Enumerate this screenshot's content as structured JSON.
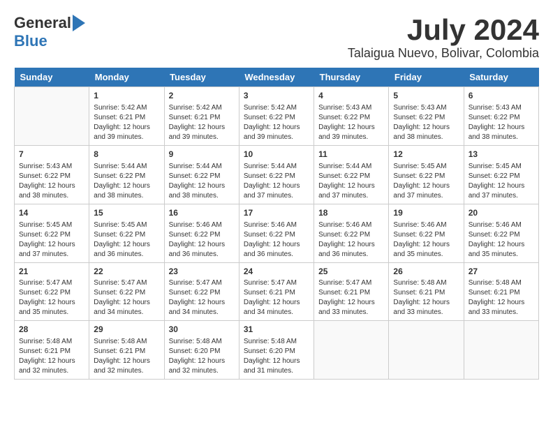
{
  "header": {
    "logo": {
      "general": "General",
      "blue": "Blue"
    },
    "month": "July 2024",
    "location": "Talaigua Nuevo, Bolivar, Colombia"
  },
  "weekdays": [
    "Sunday",
    "Monday",
    "Tuesday",
    "Wednesday",
    "Thursday",
    "Friday",
    "Saturday"
  ],
  "weeks": [
    [
      {
        "day": "",
        "content": ""
      },
      {
        "day": "1",
        "content": "Sunrise: 5:42 AM\nSunset: 6:21 PM\nDaylight: 12 hours\nand 39 minutes."
      },
      {
        "day": "2",
        "content": "Sunrise: 5:42 AM\nSunset: 6:21 PM\nDaylight: 12 hours\nand 39 minutes."
      },
      {
        "day": "3",
        "content": "Sunrise: 5:42 AM\nSunset: 6:22 PM\nDaylight: 12 hours\nand 39 minutes."
      },
      {
        "day": "4",
        "content": "Sunrise: 5:43 AM\nSunset: 6:22 PM\nDaylight: 12 hours\nand 39 minutes."
      },
      {
        "day": "5",
        "content": "Sunrise: 5:43 AM\nSunset: 6:22 PM\nDaylight: 12 hours\nand 38 minutes."
      },
      {
        "day": "6",
        "content": "Sunrise: 5:43 AM\nSunset: 6:22 PM\nDaylight: 12 hours\nand 38 minutes."
      }
    ],
    [
      {
        "day": "7",
        "content": "Sunrise: 5:43 AM\nSunset: 6:22 PM\nDaylight: 12 hours\nand 38 minutes."
      },
      {
        "day": "8",
        "content": "Sunrise: 5:44 AM\nSunset: 6:22 PM\nDaylight: 12 hours\nand 38 minutes."
      },
      {
        "day": "9",
        "content": "Sunrise: 5:44 AM\nSunset: 6:22 PM\nDaylight: 12 hours\nand 38 minutes."
      },
      {
        "day": "10",
        "content": "Sunrise: 5:44 AM\nSunset: 6:22 PM\nDaylight: 12 hours\nand 37 minutes."
      },
      {
        "day": "11",
        "content": "Sunrise: 5:44 AM\nSunset: 6:22 PM\nDaylight: 12 hours\nand 37 minutes."
      },
      {
        "day": "12",
        "content": "Sunrise: 5:45 AM\nSunset: 6:22 PM\nDaylight: 12 hours\nand 37 minutes."
      },
      {
        "day": "13",
        "content": "Sunrise: 5:45 AM\nSunset: 6:22 PM\nDaylight: 12 hours\nand 37 minutes."
      }
    ],
    [
      {
        "day": "14",
        "content": "Sunrise: 5:45 AM\nSunset: 6:22 PM\nDaylight: 12 hours\nand 37 minutes."
      },
      {
        "day": "15",
        "content": "Sunrise: 5:45 AM\nSunset: 6:22 PM\nDaylight: 12 hours\nand 36 minutes."
      },
      {
        "day": "16",
        "content": "Sunrise: 5:46 AM\nSunset: 6:22 PM\nDaylight: 12 hours\nand 36 minutes."
      },
      {
        "day": "17",
        "content": "Sunrise: 5:46 AM\nSunset: 6:22 PM\nDaylight: 12 hours\nand 36 minutes."
      },
      {
        "day": "18",
        "content": "Sunrise: 5:46 AM\nSunset: 6:22 PM\nDaylight: 12 hours\nand 36 minutes."
      },
      {
        "day": "19",
        "content": "Sunrise: 5:46 AM\nSunset: 6:22 PM\nDaylight: 12 hours\nand 35 minutes."
      },
      {
        "day": "20",
        "content": "Sunrise: 5:46 AM\nSunset: 6:22 PM\nDaylight: 12 hours\nand 35 minutes."
      }
    ],
    [
      {
        "day": "21",
        "content": "Sunrise: 5:47 AM\nSunset: 6:22 PM\nDaylight: 12 hours\nand 35 minutes."
      },
      {
        "day": "22",
        "content": "Sunrise: 5:47 AM\nSunset: 6:22 PM\nDaylight: 12 hours\nand 34 minutes."
      },
      {
        "day": "23",
        "content": "Sunrise: 5:47 AM\nSunset: 6:22 PM\nDaylight: 12 hours\nand 34 minutes."
      },
      {
        "day": "24",
        "content": "Sunrise: 5:47 AM\nSunset: 6:21 PM\nDaylight: 12 hours\nand 34 minutes."
      },
      {
        "day": "25",
        "content": "Sunrise: 5:47 AM\nSunset: 6:21 PM\nDaylight: 12 hours\nand 33 minutes."
      },
      {
        "day": "26",
        "content": "Sunrise: 5:48 AM\nSunset: 6:21 PM\nDaylight: 12 hours\nand 33 minutes."
      },
      {
        "day": "27",
        "content": "Sunrise: 5:48 AM\nSunset: 6:21 PM\nDaylight: 12 hours\nand 33 minutes."
      }
    ],
    [
      {
        "day": "28",
        "content": "Sunrise: 5:48 AM\nSunset: 6:21 PM\nDaylight: 12 hours\nand 32 minutes."
      },
      {
        "day": "29",
        "content": "Sunrise: 5:48 AM\nSunset: 6:21 PM\nDaylight: 12 hours\nand 32 minutes."
      },
      {
        "day": "30",
        "content": "Sunrise: 5:48 AM\nSunset: 6:20 PM\nDaylight: 12 hours\nand 32 minutes."
      },
      {
        "day": "31",
        "content": "Sunrise: 5:48 AM\nSunset: 6:20 PM\nDaylight: 12 hours\nand 31 minutes."
      },
      {
        "day": "",
        "content": ""
      },
      {
        "day": "",
        "content": ""
      },
      {
        "day": "",
        "content": ""
      }
    ]
  ]
}
